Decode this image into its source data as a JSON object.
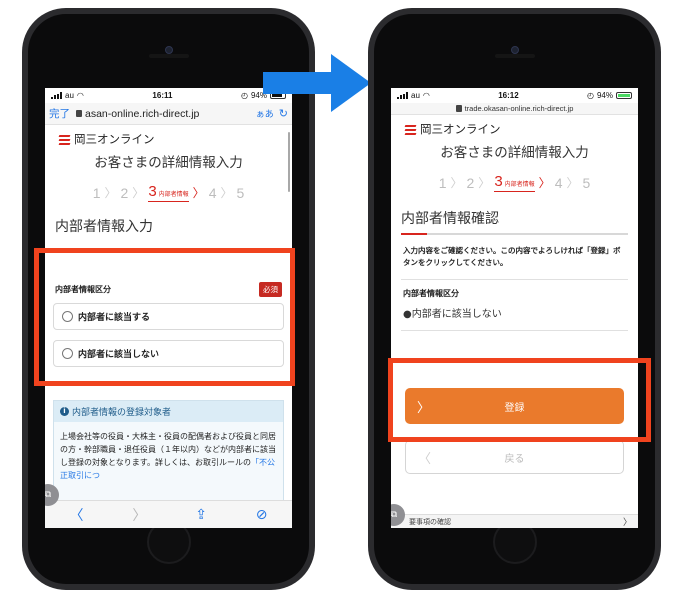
{
  "left_screen": {
    "status": {
      "carrier": "au",
      "time": "16:11",
      "battery": "94%"
    },
    "urlbar": {
      "done": "完了",
      "url": "asan-online.rich-direct.jp",
      "aa": "ぁあ",
      "reload": "↻"
    },
    "brand": "岡三オンライン",
    "heading": "お客さまの詳細情報入力",
    "steps": {
      "s1": "1",
      "s2": "2",
      "current": "3",
      "current_label": "内部者情報",
      "s4": "4",
      "s5": "5",
      "sep": "〉"
    },
    "section_title": "内部者情報入力",
    "field_label": "内部者情報区分",
    "required": "必須",
    "option_yes": "内部者に該当する",
    "option_no": "内部者に該当しない",
    "info_title": "内部者情報の登録対象者",
    "info_body": "上場会社等の役員・大株主・役員の配偶者および役員と同居の方・幹部職員・退任役員（１年以内）などが内部者に該当し登録の対象となります。詳しくは、お取引ルールの",
    "info_link": "「不公正取引につ",
    "toolbar": {
      "back": "〈",
      "forward": "〉",
      "share": "⇪",
      "compass": "⊘",
      "tabs": "⧉"
    }
  },
  "right_screen": {
    "status": {
      "carrier": "au",
      "time": "16:12",
      "battery": "94%"
    },
    "url": "trade.okasan-online.rich-direct.jp",
    "brand": "岡三オンライン",
    "heading": "お客さまの詳細情報入力",
    "steps": {
      "s1": "1",
      "s2": "2",
      "current": "3",
      "current_label": "内部者情報",
      "s4": "4",
      "s5": "5",
      "sep": "〉"
    },
    "confirm_title": "内部者情報確認",
    "confirm_note": "入力内容をご確認ください。この内容でよろしければ「登録」ボタンをクリックしてください。",
    "field_label": "内部者情報区分",
    "field_value": "●内部者に該当しない",
    "register_label": "登録",
    "back_label": "戻る",
    "bottom_link": "要事項の確認",
    "chev": "〉",
    "chev_left": "〈",
    "tabs": "⧉"
  },
  "colors": {
    "highlight": "#f0431e",
    "arrow": "#1a7fe6",
    "brand_red": "#d8251e",
    "register": "#ea7a2c"
  }
}
